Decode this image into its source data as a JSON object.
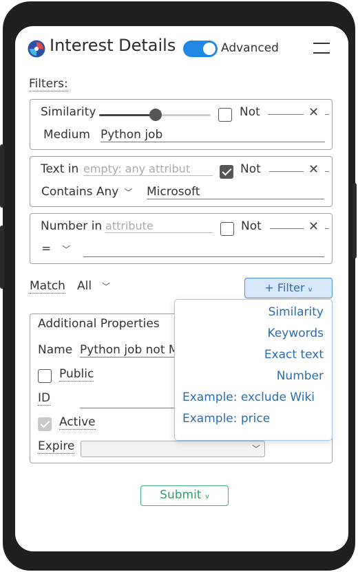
{
  "header": {
    "title": "Interest Details",
    "advanced_label": "Advanced",
    "advanced_on": true
  },
  "filters_label": "Filters:",
  "filter1": {
    "label": "Similarity",
    "slider_value": 0.45,
    "not_label": "Not",
    "not_checked": false,
    "level": "Medium",
    "text": "Python job"
  },
  "filter2": {
    "label": "Text in",
    "placeholder": "empty: any attribut",
    "not_label": "Not",
    "not_checked": true,
    "mode": "Contains Any",
    "text": "Microsoft"
  },
  "filter3": {
    "label": "Number in",
    "placeholder": "attribute",
    "not_label": "Not",
    "not_checked": false,
    "operator": "=",
    "value": ""
  },
  "match": {
    "label": "Match",
    "value": "All"
  },
  "add_filter_button": "+ Filter",
  "add_filter_menu": [
    "Similarity",
    "Keywords",
    "Exact text",
    "Number",
    "Example: exclude Wiki",
    "Example: price"
  ],
  "additional": {
    "title": "Additional Properties",
    "name_label": "Name",
    "name_value": "Python job not M",
    "public_label": "Public",
    "public_checked": false,
    "id_label": "ID",
    "id_value": "",
    "active_label": "Active",
    "active_checked": true,
    "expire_label": "Expire",
    "expire_value": ""
  },
  "submit_button": "Submit",
  "icons": {
    "logo": "app-logo-icon",
    "menu": "hamburger-menu-icon",
    "remove": "close-icon",
    "dropdown": "chevron-down-icon"
  },
  "colors": {
    "accent": "#1e88e5",
    "link": "#2b6cb0",
    "submit": "#2f9e69"
  }
}
